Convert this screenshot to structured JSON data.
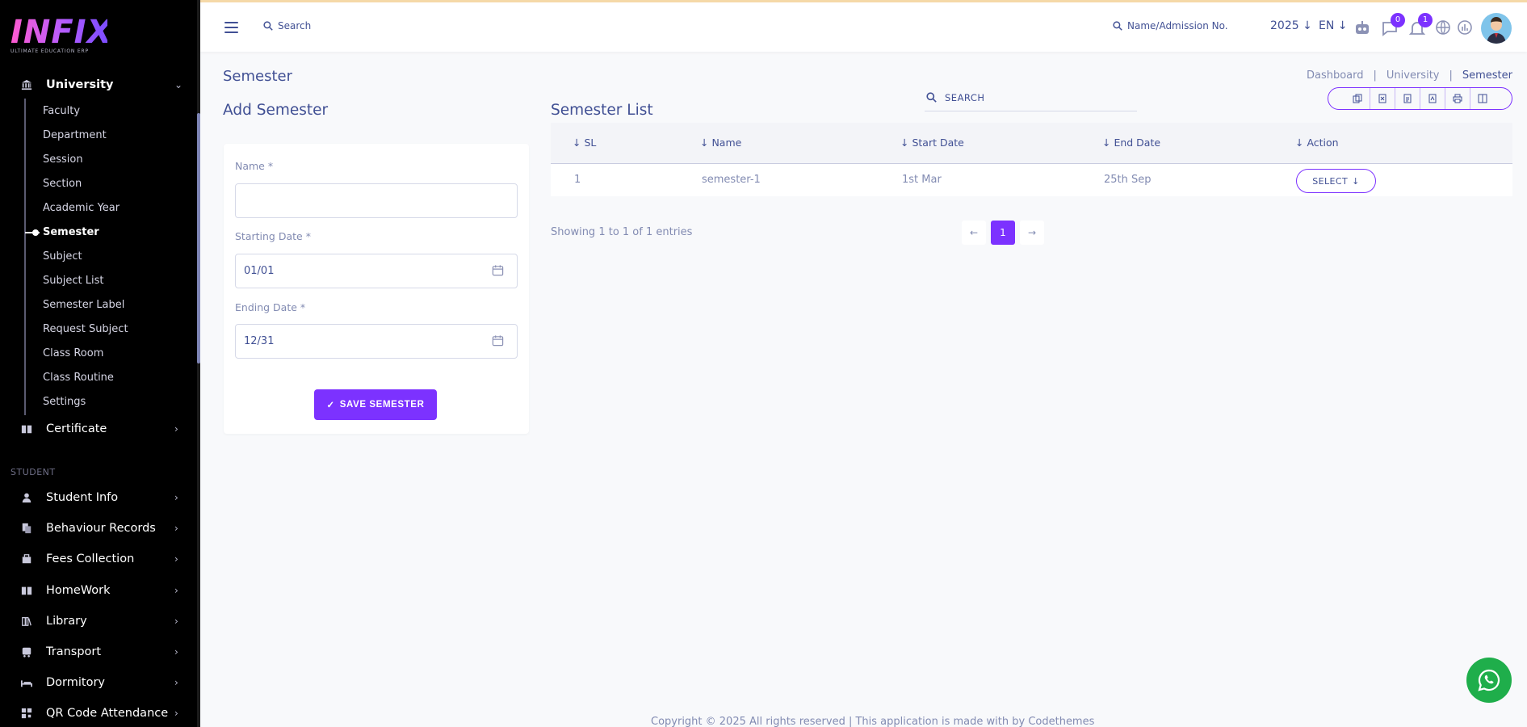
{
  "brand": {
    "logo_text": "INFIX",
    "logo_sub": "ULTIMATE EDUCATION ERP"
  },
  "sidebar": {
    "university": {
      "label": "University"
    },
    "sub_items": [
      {
        "label": "Faculty"
      },
      {
        "label": "Department"
      },
      {
        "label": "Session"
      },
      {
        "label": "Section"
      },
      {
        "label": "Academic Year"
      },
      {
        "label": "Semester",
        "active": true
      },
      {
        "label": "Subject"
      },
      {
        "label": "Subject List"
      },
      {
        "label": "Semester Label"
      },
      {
        "label": "Request Subject"
      },
      {
        "label": "Class Room"
      },
      {
        "label": "Class Routine"
      },
      {
        "label": "Settings"
      }
    ],
    "certificate": {
      "label": "Certificate"
    },
    "section_label": "STUDENT",
    "groups": [
      {
        "label": "Student Info",
        "icon": "user-icon"
      },
      {
        "label": "Behaviour Records",
        "icon": "records-icon"
      },
      {
        "label": "Fees Collection",
        "icon": "fees-icon"
      },
      {
        "label": "HomeWork",
        "icon": "book-icon"
      },
      {
        "label": "Library",
        "icon": "library-icon"
      },
      {
        "label": "Transport",
        "icon": "bus-icon"
      },
      {
        "label": "Dormitory",
        "icon": "bed-icon"
      },
      {
        "label": "QR Code Attendance",
        "icon": "qr-icon"
      }
    ]
  },
  "header": {
    "search_label": "Search",
    "admission_search": "Name/Admission No.",
    "year": "2025",
    "lang": "EN",
    "chat_badge": "0",
    "notif_badge": "1"
  },
  "page": {
    "title": "Semester",
    "breadcrumb": [
      "Dashboard",
      "University",
      "Semester"
    ]
  },
  "form": {
    "title": "Add Semester",
    "name_label": "Name *",
    "name_value": "",
    "start_label": "Starting Date *",
    "start_value": "01/01",
    "end_label": "Ending Date *",
    "end_value": "12/31",
    "save_label": "SAVE SEMESTER"
  },
  "list": {
    "title": "Semester List",
    "search_label": "SEARCH",
    "columns": [
      "SL",
      "Name",
      "Start Date",
      "End Date",
      "Action"
    ],
    "rows": [
      {
        "sl": "1",
        "name": "semester-1",
        "start": "1st Mar",
        "end": "25th Sep",
        "action": "SELECT"
      }
    ],
    "showing": "Showing 1 to 1 of 1 entries",
    "current_page": "1"
  },
  "footer": {
    "text": "Copyright © 2025 All rights reserved | This application is made with by Codethemes"
  },
  "colors": {
    "accent": "#7c32ff",
    "text": "#415094",
    "muted": "#828bb2",
    "whatsapp": "#1fae4b"
  }
}
